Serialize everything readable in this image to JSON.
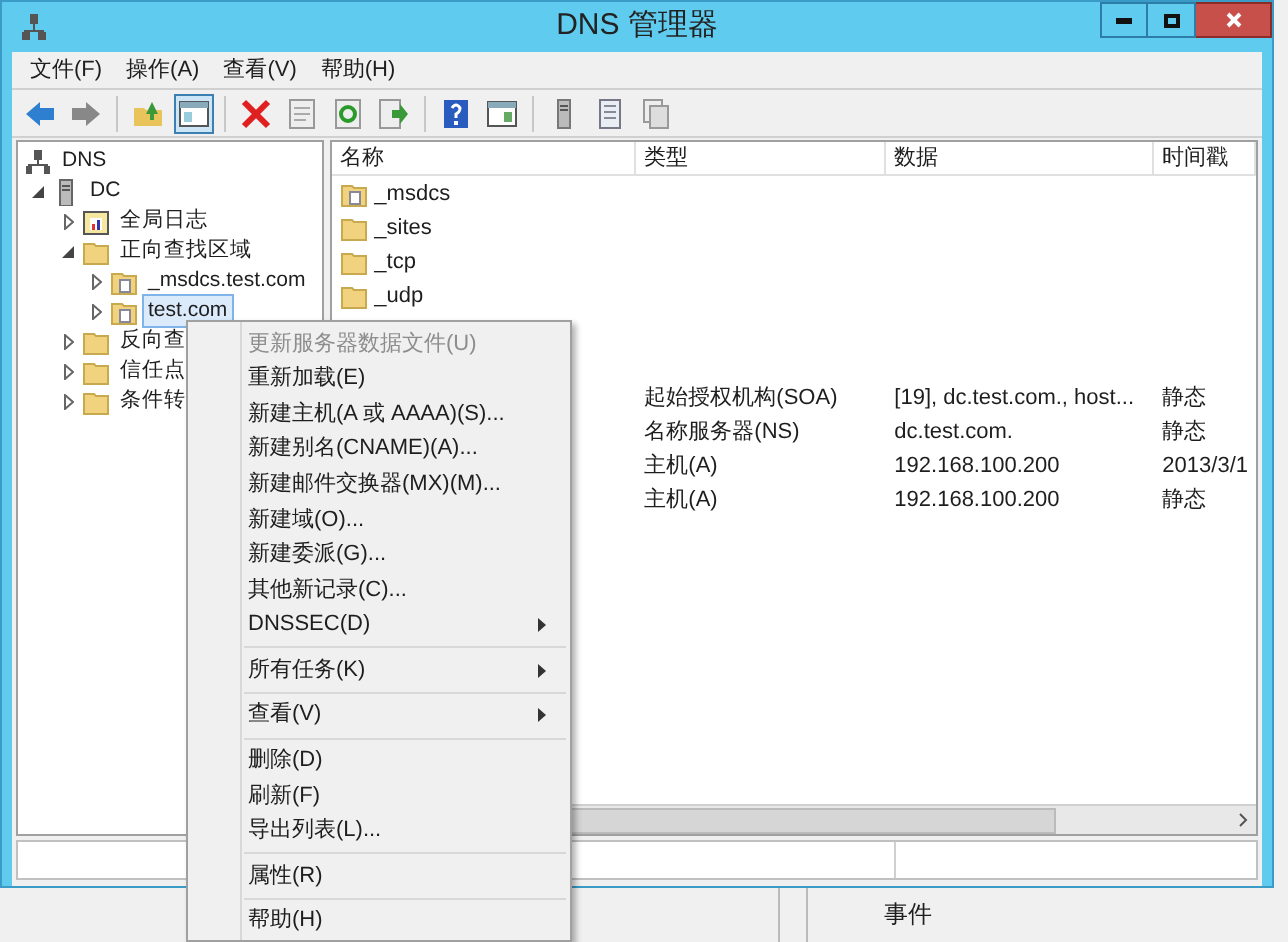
{
  "window": {
    "title": "DNS 管理器"
  },
  "menu_bar": [
    "文件(F)",
    "操作(A)",
    "查看(V)",
    "帮助(H)"
  ],
  "toolbar": [
    {
      "kind": "back"
    },
    {
      "kind": "forward"
    },
    {
      "kind": "sep"
    },
    {
      "kind": "up"
    },
    {
      "kind": "tree",
      "selected": true
    },
    {
      "kind": "sep"
    },
    {
      "kind": "delete"
    },
    {
      "kind": "props"
    },
    {
      "kind": "refresh"
    },
    {
      "kind": "export"
    },
    {
      "kind": "sep"
    },
    {
      "kind": "help"
    },
    {
      "kind": "console"
    },
    {
      "kind": "sep"
    },
    {
      "kind": "server"
    },
    {
      "kind": "list"
    },
    {
      "kind": "copy"
    }
  ],
  "tree": [
    {
      "label": "DNS",
      "kind": "dns",
      "selected": false,
      "children": [
        {
          "label": "DC",
          "kind": "server",
          "expanded": true,
          "selected": false,
          "children": [
            {
              "label": "全局日志",
              "kind": "log",
              "expanded": false,
              "selected": false
            },
            {
              "label": "正向查找区域",
              "kind": "folder",
              "expanded": true,
              "selected": false,
              "children": [
                {
                  "label": "_msdcs.test.com",
                  "kind": "zone",
                  "expanded": false,
                  "selected": false
                },
                {
                  "label": "test.com",
                  "kind": "zone",
                  "expanded": false,
                  "selected": true
                }
              ]
            },
            {
              "label": "反向查",
              "kind": "folder",
              "expanded": false,
              "selected": false
            },
            {
              "label": "信任点",
              "kind": "folder",
              "expanded": false,
              "selected": false
            },
            {
              "label": "条件转",
              "kind": "folder",
              "expanded": false,
              "selected": false
            }
          ]
        }
      ]
    }
  ],
  "list": {
    "columns": [
      "名称",
      "类型",
      "数据",
      "时间戳"
    ],
    "rows": [
      {
        "kind": "zone",
        "name": "_msdcs"
      },
      {
        "kind": "folder",
        "name": "_sites"
      },
      {
        "kind": "folder",
        "name": "_tcp"
      },
      {
        "kind": "folder",
        "name": "_udp"
      },
      {
        "kind": "record"
      },
      {
        "kind": "record"
      },
      {
        "kind": "record",
        "type": "起始授权机构(SOA)",
        "data": "[19], dc.test.com., host...",
        "timestamp": "静态"
      },
      {
        "kind": "record",
        "type": "名称服务器(NS)",
        "data": "dc.test.com.",
        "timestamp": "静态"
      },
      {
        "kind": "record",
        "type": "主机(A)",
        "data": "192.168.100.200",
        "timestamp": "2013/3/1"
      },
      {
        "kind": "record",
        "type": "主机(A)",
        "data": "192.168.100.200",
        "timestamp": "静态"
      }
    ]
  },
  "context_menu": [
    {
      "kind": "item",
      "label": "更新服务器数据文件(U)",
      "disabled": true
    },
    {
      "kind": "item",
      "label": "重新加载(E)",
      "disabled": false
    },
    {
      "kind": "item",
      "label": "新建主机(A 或 AAAA)(S)...",
      "disabled": false
    },
    {
      "kind": "item",
      "label": "新建别名(CNAME)(A)...",
      "disabled": false
    },
    {
      "kind": "item",
      "label": "新建邮件交换器(MX)(M)...",
      "disabled": false
    },
    {
      "kind": "item",
      "label": "新建域(O)...",
      "disabled": false
    },
    {
      "kind": "item",
      "label": "新建委派(G)...",
      "disabled": false
    },
    {
      "kind": "item",
      "label": "其他新记录(C)...",
      "disabled": false
    },
    {
      "kind": "submenu",
      "label": "DNSSEC(D)",
      "disabled": false
    },
    {
      "kind": "sep"
    },
    {
      "kind": "submenu",
      "label": "所有任务(K)",
      "disabled": false
    },
    {
      "kind": "sep"
    },
    {
      "kind": "submenu",
      "label": "查看(V)",
      "disabled": false
    },
    {
      "kind": "sep"
    },
    {
      "kind": "item",
      "label": "删除(D)",
      "disabled": false
    },
    {
      "kind": "item",
      "label": "刷新(F)",
      "disabled": false
    },
    {
      "kind": "item",
      "label": "导出列表(L)...",
      "disabled": false
    },
    {
      "kind": "sep"
    },
    {
      "kind": "item",
      "label": "属性(R)",
      "disabled": false
    },
    {
      "kind": "sep"
    },
    {
      "kind": "item",
      "label": "帮助(H)",
      "disabled": false
    }
  ],
  "taskbar": {
    "label": "事件"
  }
}
